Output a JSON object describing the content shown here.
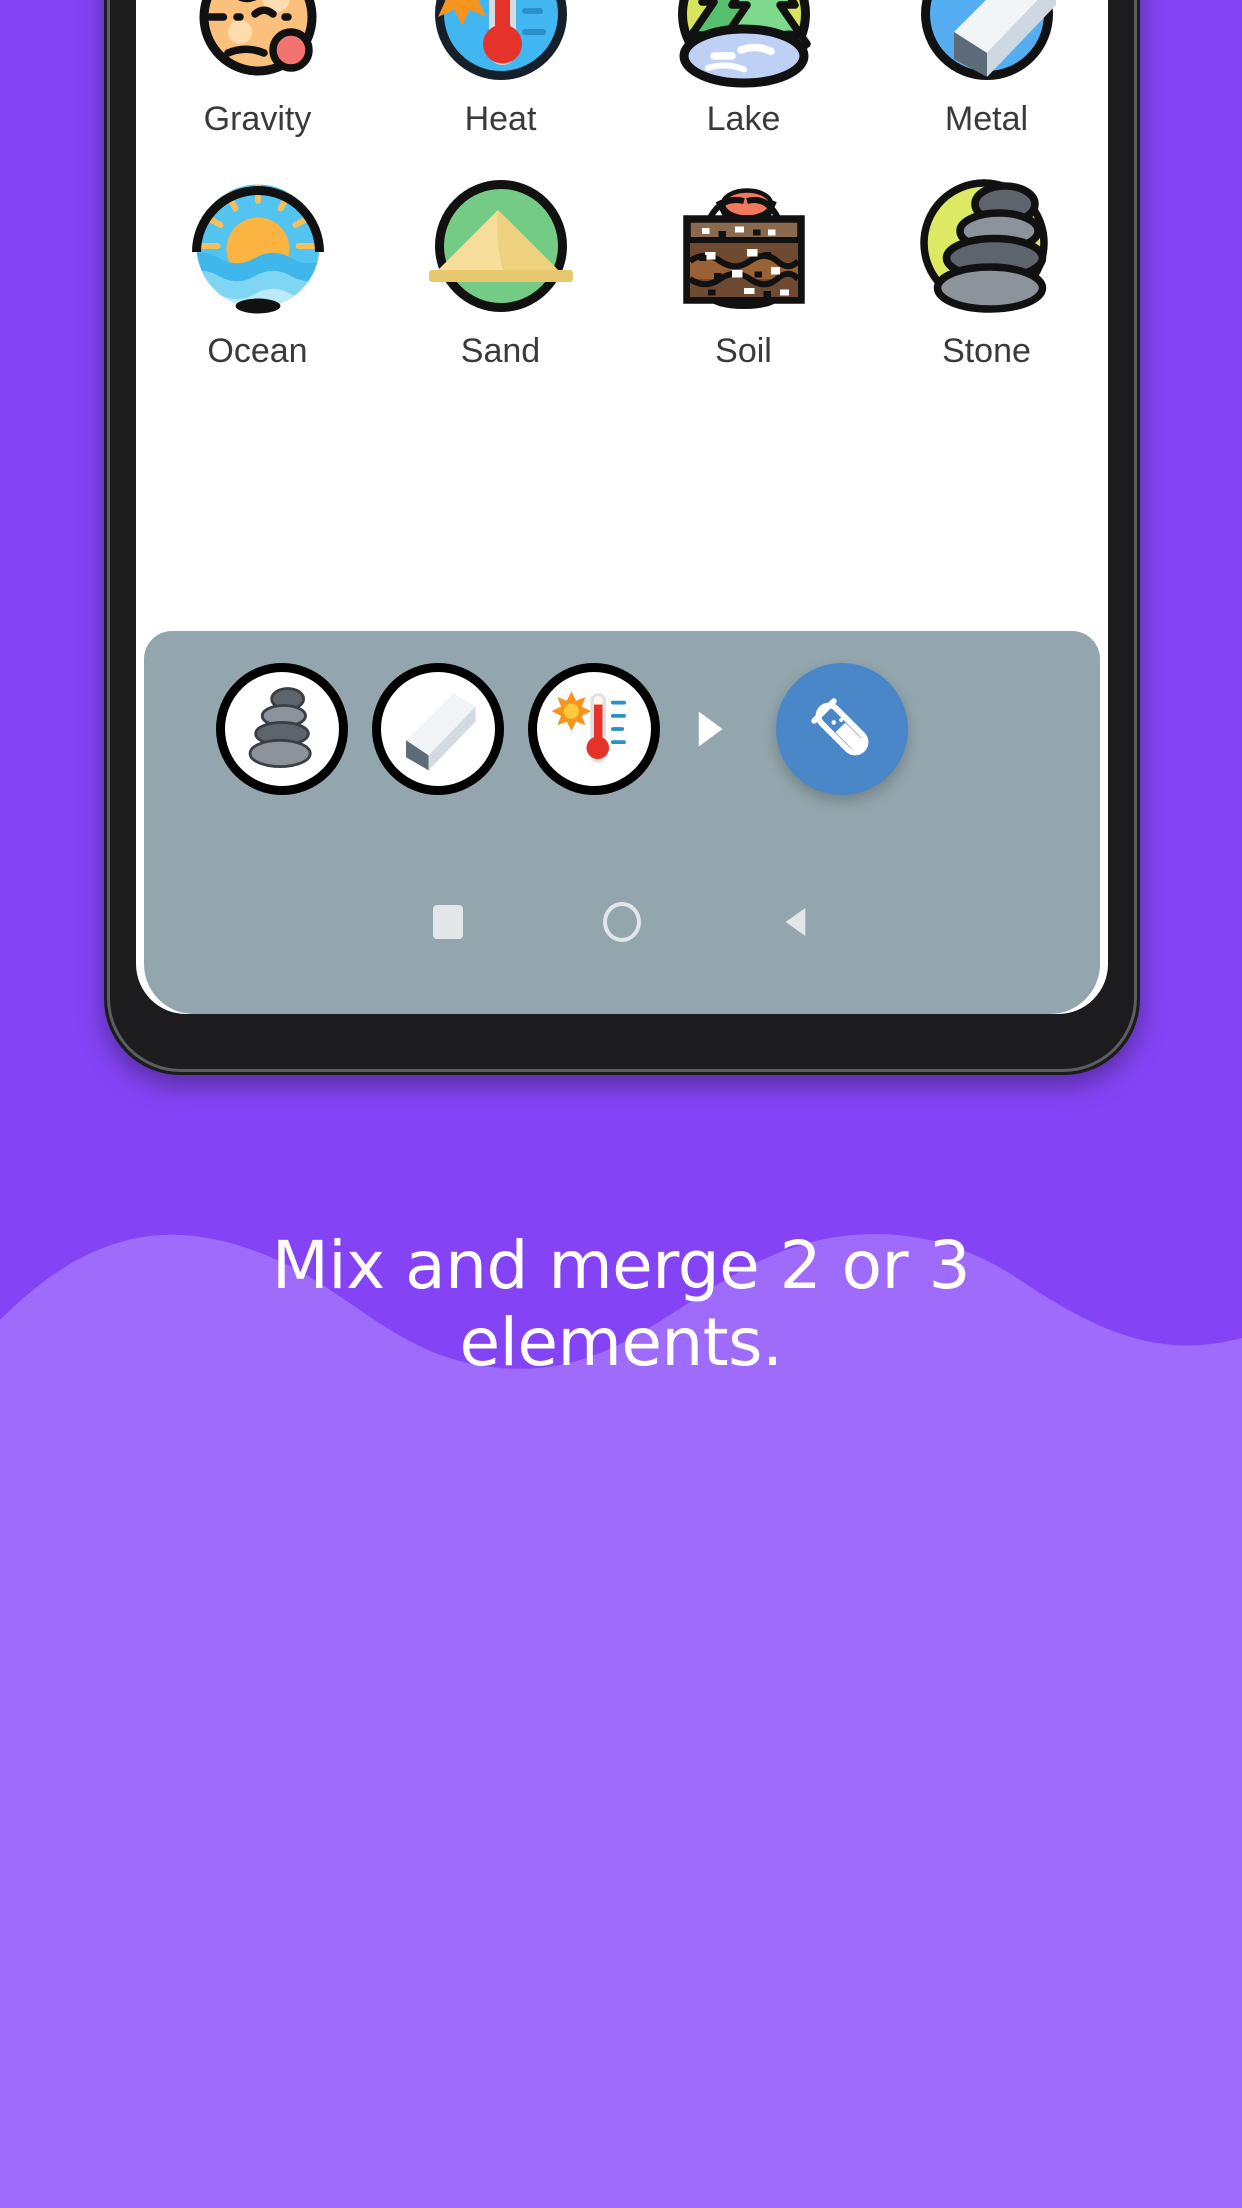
{
  "theme": {
    "page_background": "#8444f5",
    "wave_light": "#9f6bfa",
    "tray_background": "#93a6ad",
    "fab_color": "#4a87c8",
    "screen_background": "#ffffff",
    "phone_frame": "#1c1c1e",
    "label_color": "#3a3a3a",
    "caption_color": "#ffffff"
  },
  "caption": {
    "line1": "Mix and merge 2 or 3",
    "line2": "elements."
  },
  "element_grid": {
    "rows": [
      {
        "cells": [
          {
            "label": "Gravity",
            "icon": "gravity-planet-icon"
          },
          {
            "label": "Heat",
            "icon": "heat-thermometer-icon"
          },
          {
            "label": "Lake",
            "icon": "lake-forest-icon"
          },
          {
            "label": "Metal",
            "icon": "metal-bar-icon"
          }
        ]
      },
      {
        "cells": [
          {
            "label": "Ocean",
            "icon": "ocean-sunset-icon"
          },
          {
            "label": "Sand",
            "icon": "sand-dune-icon"
          },
          {
            "label": "Soil",
            "icon": "soil-layers-icon"
          },
          {
            "label": "Stone",
            "icon": "stone-cairn-icon"
          }
        ]
      }
    ]
  },
  "mixer_tray": {
    "slots": [
      {
        "label": "Stone",
        "icon": "stone-cairn-icon"
      },
      {
        "label": "Metal",
        "icon": "metal-bar-icon"
      },
      {
        "label": "Heat",
        "icon": "heat-thermometer-icon"
      }
    ],
    "arrow_icon": "play-triangle-icon",
    "mix_button": {
      "icon": "test-tube-icon"
    }
  },
  "android_navbar": {
    "buttons": [
      {
        "name": "recents",
        "icon": "square-icon"
      },
      {
        "name": "home",
        "icon": "circle-icon"
      },
      {
        "name": "back",
        "icon": "back-triangle-icon"
      }
    ]
  }
}
